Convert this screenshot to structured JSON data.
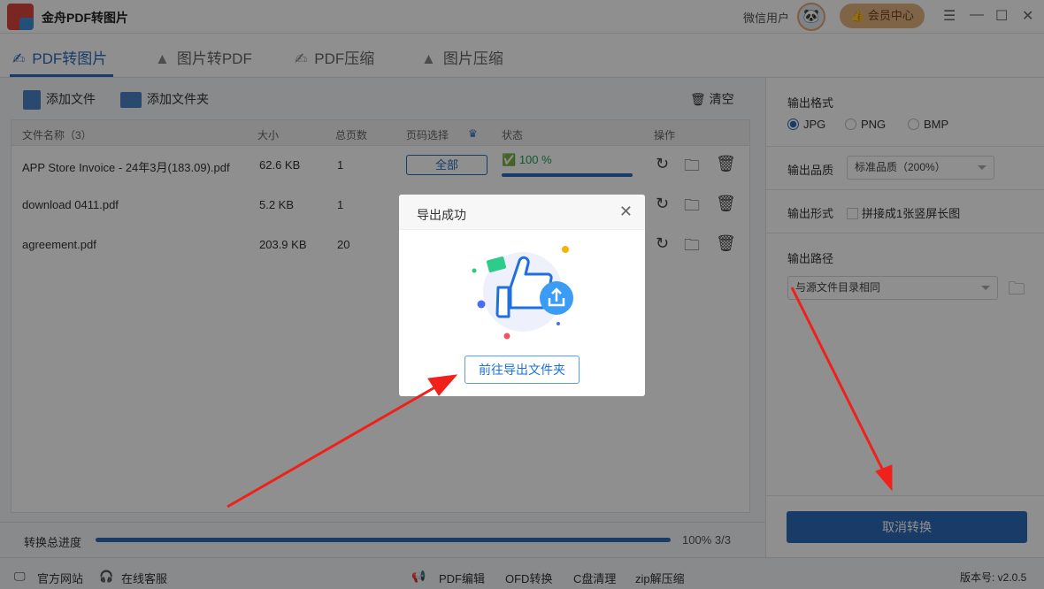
{
  "app": {
    "title": "金舟PDF转图片",
    "user": "微信用户",
    "vip": "会员中心"
  },
  "tabs": [
    {
      "label": "PDF转图片"
    },
    {
      "label": "图片转PDF"
    },
    {
      "label": "PDF压缩"
    },
    {
      "label": "图片压缩"
    }
  ],
  "toolbar": {
    "add_file": "添加文件",
    "add_folder": "添加文件夹",
    "clear": "清空"
  },
  "table": {
    "headers": [
      "文件名称（3）",
      "大小",
      "总页数",
      "页码选择",
      "状态",
      "操作"
    ],
    "rows": [
      {
        "name": "APP Store Invoice - 24年3月(183.09).pdf",
        "size": "62.6 KB",
        "pages": "1",
        "range": "全部",
        "status": "100 %",
        "progress": 100
      },
      {
        "name": "download 0411.pdf",
        "size": "5.2 KB",
        "pages": "1"
      },
      {
        "name": "agreement.pdf",
        "size": "203.9 KB",
        "pages": "20"
      }
    ]
  },
  "progress": {
    "label": "转换总进度",
    "value": "100% 3/3",
    "percent": 100
  },
  "settings": {
    "format_label": "输出格式",
    "formats": [
      "JPG",
      "PNG",
      "BMP"
    ],
    "format_selected": "JPG",
    "quality_label": "输出品质",
    "quality_value": "标准品质（200%）",
    "form_label": "输出形式",
    "form_option": "拼接成1张竖屏长图",
    "path_label": "输出路径",
    "path_value": "与源文件目录相同",
    "cancel": "取消转换"
  },
  "footer": {
    "site": "官方网站",
    "service": "在线客服",
    "links": [
      "PDF编辑",
      "OFD转换",
      "C盘清理",
      "zip解压缩"
    ],
    "version": "版本号: v2.0.5"
  },
  "modal": {
    "title": "导出成功",
    "button": "前往导出文件夹"
  },
  "colors": {
    "accent": "#2c6cb8",
    "success": "#1f9c57",
    "arrow": "#f0201a"
  }
}
